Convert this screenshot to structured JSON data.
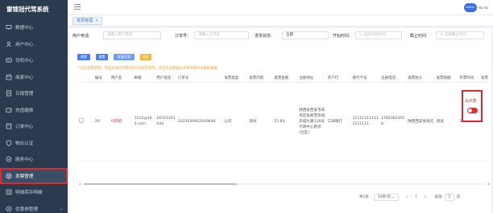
{
  "app": {
    "title": "雷锦冠代驾系统"
  },
  "user": {
    "avatar_text": "admin",
    "name": "Ha Ha"
  },
  "sidebar": {
    "items": [
      {
        "label": "数据中心",
        "icon": "monitor-icon"
      },
      {
        "label": "用户中心",
        "icon": "user-icon"
      },
      {
        "label": "司机中心",
        "icon": "id-card-icon"
      },
      {
        "label": "商家中心",
        "icon": "shop-icon"
      },
      {
        "label": "日报管理",
        "icon": "document-icon"
      },
      {
        "label": "充值缴费",
        "icon": "wallet-icon"
      },
      {
        "label": "订单中心",
        "icon": "order-icon"
      },
      {
        "label": "物业认证",
        "icon": "shield-icon"
      },
      {
        "label": "服务中心",
        "icon": "service-icon"
      },
      {
        "label": "发票管理",
        "icon": "invoice-icon",
        "active": true
      },
      {
        "label": "明细库存明细",
        "icon": "list-icon"
      },
      {
        "label": "优惠券管理",
        "icon": "coupon-icon",
        "chevron": true
      }
    ]
  },
  "tabs": [
    {
      "label": "发票管理",
      "close": "×"
    }
  ],
  "filters": {
    "phone_label": "用户电话:",
    "phone_placeholder": "请输入用户电话",
    "order_label": "订单号:",
    "order_placeholder": "请输入订单号",
    "status_label": "发票状态:",
    "status_value": "全部",
    "start_label": "开始时间:",
    "start_placeholder": "选择开始时间",
    "end_label": "截止时间:",
    "end_placeholder": "选择截止时间"
  },
  "buttons": {
    "search": "搜索",
    "reset": "重置",
    "batch": "批量开票",
    "export": "导出"
  },
  "notice": "* 开出发票退款，导出发票待开票时间3月后可获得，开出导出数据以开票日期为准审批数据",
  "table": {
    "headers": [
      "",
      "编号",
      "用户名",
      "邮箱",
      "用户电话",
      "订单号",
      "发票类型",
      "发票内容",
      "发票金额",
      "注册地址",
      "开户行",
      "银行卡号",
      "注册电话",
      "发票抬头",
      "发票税额",
      "开票时间",
      "发票状态"
    ],
    "row": {
      "id": "26",
      "username": "付四奶",
      "email": "1111@163.com",
      "phone": "18743301034",
      "order_no": "2023030062939648",
      "invoice_type": "公司",
      "content": "测试",
      "amount": "15.84",
      "address": "陕西省西安市未央区张家堡街道凤城九路126号行政中心附近(社区)",
      "bank": "工商银行",
      "card": "111111111111111111",
      "reg_phone": "17663623558",
      "title": "陕西西安省钱元",
      "tax": "测试",
      "time": "2023/09",
      "status_text": "去开票"
    }
  },
  "pagination": {
    "total": "共1条",
    "page_size": "10条/页",
    "prev": "<",
    "page": "1",
    "next": ">",
    "goto_label": "前往",
    "goto_value": "1",
    "goto_unit": "页"
  }
}
